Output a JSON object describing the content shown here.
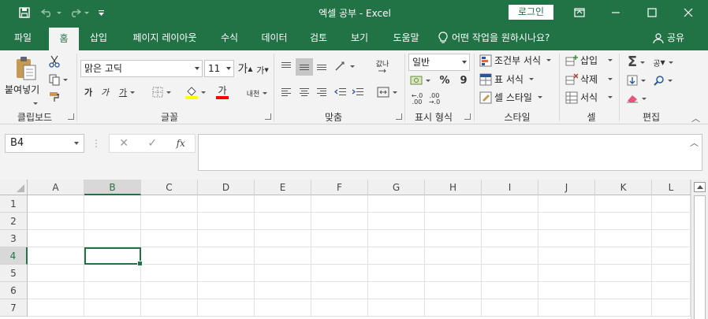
{
  "titlebar": {
    "title": "엑셀 공부  -  Excel",
    "login_label": "로그인"
  },
  "tabs": [
    "파일",
    "홈",
    "삽입",
    "페이지 레이아웃",
    "수식",
    "데이터",
    "검토",
    "보기",
    "도움말"
  ],
  "active_tab": "홈",
  "tellme_label": "어떤 작업을 원하시나요?",
  "share_label": "공유",
  "ribbon": {
    "groups": {
      "clipboard": "클립보드",
      "font": "글꼴",
      "alignment": "맞춤",
      "number": "표시 형식",
      "styles": "스타일",
      "cells": "셀",
      "editing": "편집"
    },
    "paste_label": "붙여넣기",
    "font_name": "맑은 고딕",
    "font_size": "11",
    "grow_font": "가",
    "shrink_font": "가",
    "bold": "가",
    "italic": "가",
    "underline": "가",
    "font_color_glyph": "가",
    "phonetic_label": "내천",
    "wrap_label": "값나",
    "number_format": "일반",
    "percent": "%",
    "comma": "9",
    "conditional_format": "조건부 서식",
    "format_as_table": "표 서식",
    "cell_styles": "셀 스타일",
    "insert": "삽입",
    "delete": "삭제",
    "format": "서식",
    "sort_label": "공",
    "accent_color": "#217346",
    "fill_color": "#ffff00",
    "font_color": "#ff0000"
  },
  "formula_bar": {
    "name_box": "B4",
    "fx": "fx",
    "formula": ""
  },
  "grid": {
    "columns": [
      "A",
      "B",
      "C",
      "D",
      "E",
      "F",
      "G",
      "H",
      "I",
      "J",
      "K",
      "L"
    ],
    "rows": [
      "1",
      "2",
      "3",
      "4",
      "5",
      "6",
      "7"
    ],
    "selected_cell": "B4"
  }
}
